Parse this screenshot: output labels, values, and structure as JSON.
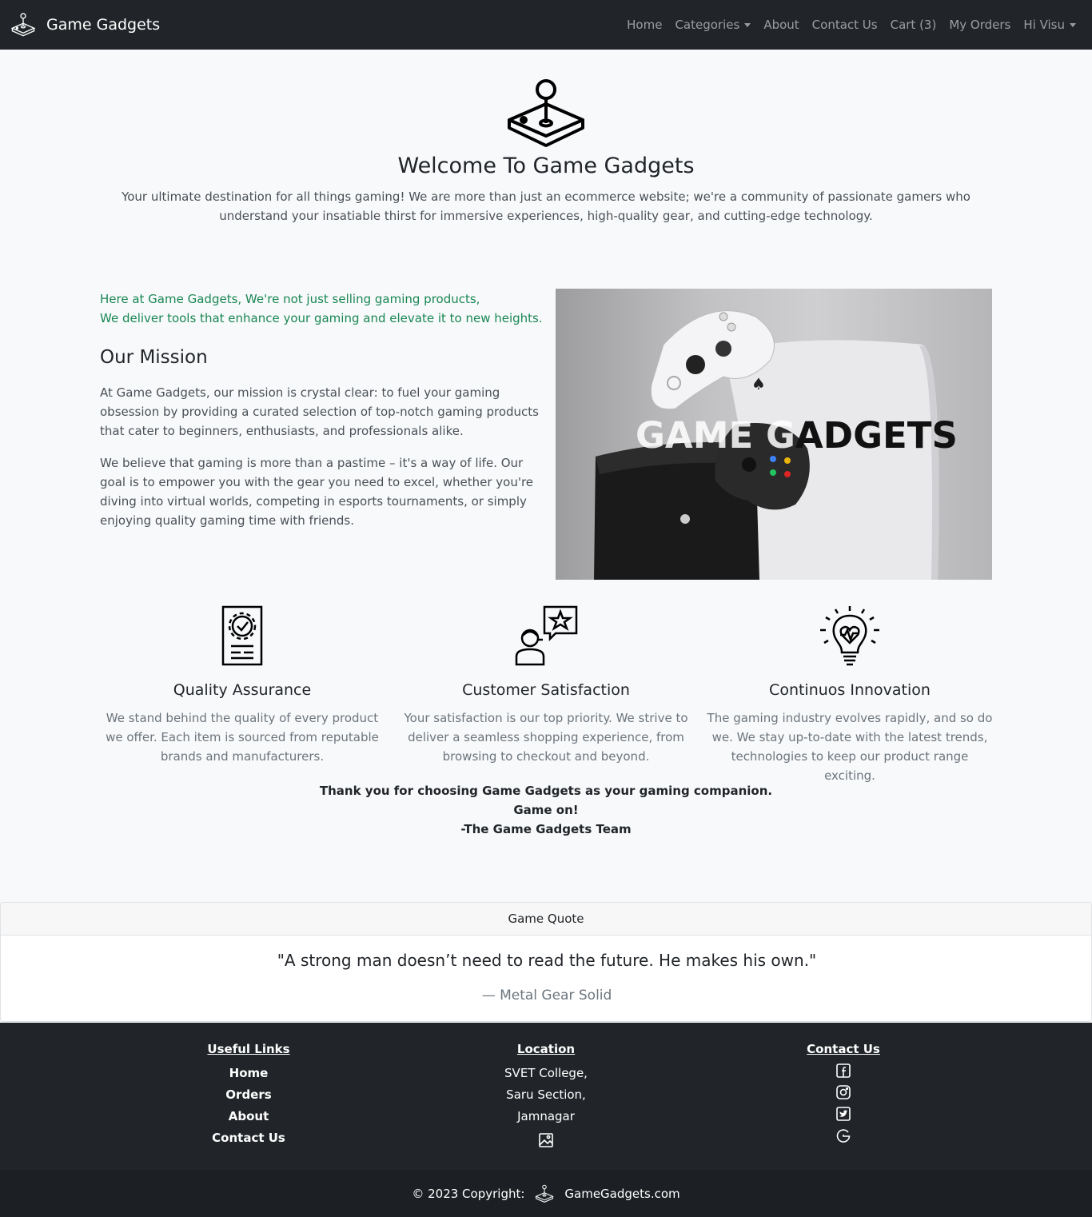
{
  "navbar": {
    "brand": "Game Gadgets",
    "links": {
      "home": "Home",
      "categories": "Categories",
      "about": "About",
      "contact": "Contact Us",
      "cart": "Cart (3)",
      "orders": "My Orders",
      "user": "Hi Visu"
    }
  },
  "hero": {
    "title": "Welcome To Game Gadgets",
    "lead": "Your ultimate destination for all things gaming! We are more than just an ecommerce website; we're a community of passionate gamers who understand your insatiable thirst for immersive experiences, high-quality gear, and cutting-edge technology."
  },
  "mission": {
    "tagline_line1": "Here at Game Gadgets, We're not just selling gaming products,",
    "tagline_line2": "We deliver tools that enhance your gaming and elevate it to new heights.",
    "heading": "Our Mission",
    "p1": "At Game Gadgets, our mission is crystal clear: to fuel your gaming obsession by providing a curated selection of top-notch gaming products that cater to beginners, enthusiasts, and professionals alike.",
    "p2": "We believe that gaming is more than a pastime – it's a way of life. Our goal is to empower you with the gear you need to excel, whether you're diving into virtual worlds, competing in esports tournaments, or simply enjoying quality gaming time with friends.",
    "image_text_light": "GAME G",
    "image_text_dark": "ADGETS"
  },
  "features": [
    {
      "title": "Quality Assurance",
      "text": "We stand behind the quality of every product we offer. Each item is sourced from reputable brands and manufacturers."
    },
    {
      "title": "Customer Satisfaction",
      "text": "Your satisfaction is our top priority. We strive to deliver a seamless shopping experience, from browsing to checkout and beyond."
    },
    {
      "title": "Continuos Innovation",
      "text": "The gaming industry evolves rapidly, and so do we. We stay up-to-date with the latest trends, technologies to keep our product range exciting."
    }
  ],
  "thanks": {
    "line1": "Thank you for choosing Game Gadgets as your gaming companion.",
    "line2": "Game on!",
    "line3": "-The Game Gadgets Team"
  },
  "quote": {
    "header": "Game Quote",
    "text": "\"A strong man doesn’t need to read the future. He makes his own.\"",
    "source": "— Metal Gear Solid"
  },
  "footer": {
    "useful_links": {
      "heading": "Useful Links",
      "items": [
        "Home",
        "Orders",
        "About",
        "Contact Us"
      ]
    },
    "location": {
      "heading": "Location",
      "lines": [
        "SVET College,",
        "Saru Section,",
        "Jamnagar"
      ]
    },
    "contact": {
      "heading": "Contact Us",
      "icons": [
        "facebook-icon",
        "instagram-icon",
        "twitter-icon",
        "google-icon"
      ]
    },
    "copyright_label": "© 2023 Copyright:",
    "copyright_site": "GameGadgets.com"
  }
}
